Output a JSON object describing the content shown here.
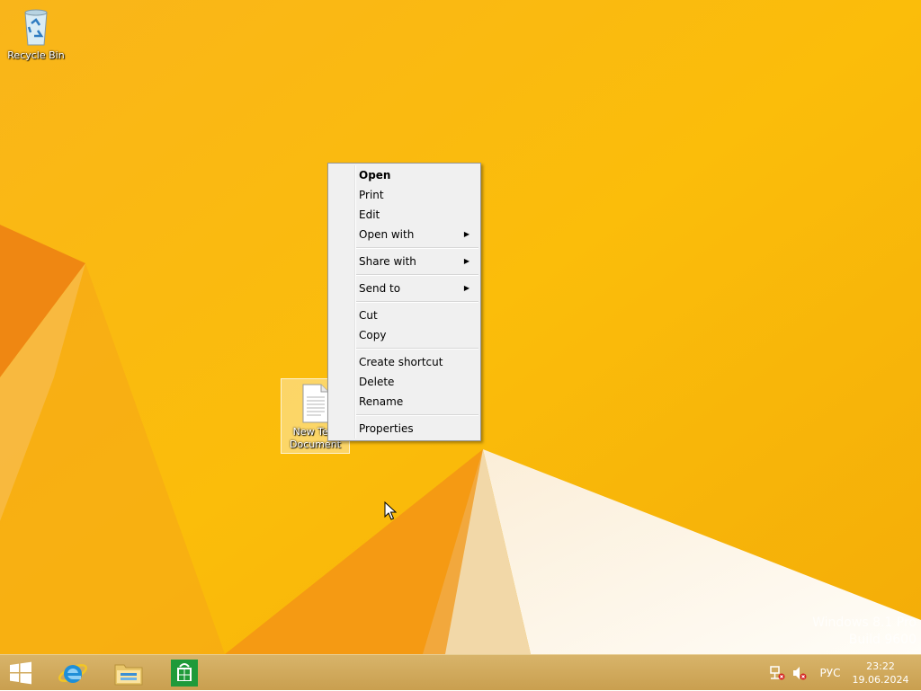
{
  "desktop": {
    "icons": [
      {
        "label": "Recycle Bin"
      },
      {
        "label": "New Text Document"
      }
    ],
    "watermark": {
      "line1": "Windows 8.1 Pro",
      "line2": "Build 9600"
    }
  },
  "context_menu": {
    "items": [
      {
        "label": "Open",
        "bold": true
      },
      {
        "label": "Print"
      },
      {
        "label": "Edit"
      },
      {
        "label": "Open with",
        "submenu": true
      },
      {
        "label": "Share with",
        "submenu": true
      },
      {
        "label": "Send to",
        "submenu": true
      },
      {
        "label": "Cut"
      },
      {
        "label": "Copy"
      },
      {
        "label": "Create shortcut"
      },
      {
        "label": "Delete"
      },
      {
        "label": "Rename"
      },
      {
        "label": "Properties"
      }
    ]
  },
  "taskbar": {
    "language": "РУС",
    "time": "23:22",
    "date": "19.06.2024"
  },
  "colors": {
    "wallpaper": "#f7b70f",
    "taskbar": "#cfa756",
    "accent": "#000000"
  },
  "icons": [
    "recycle-bin-icon",
    "text-file-icon",
    "windows-logo-icon",
    "internet-explorer-icon",
    "file-explorer-icon",
    "store-icon",
    "network-icon",
    "volume-muted-icon",
    "mouse-cursor-icon"
  ]
}
